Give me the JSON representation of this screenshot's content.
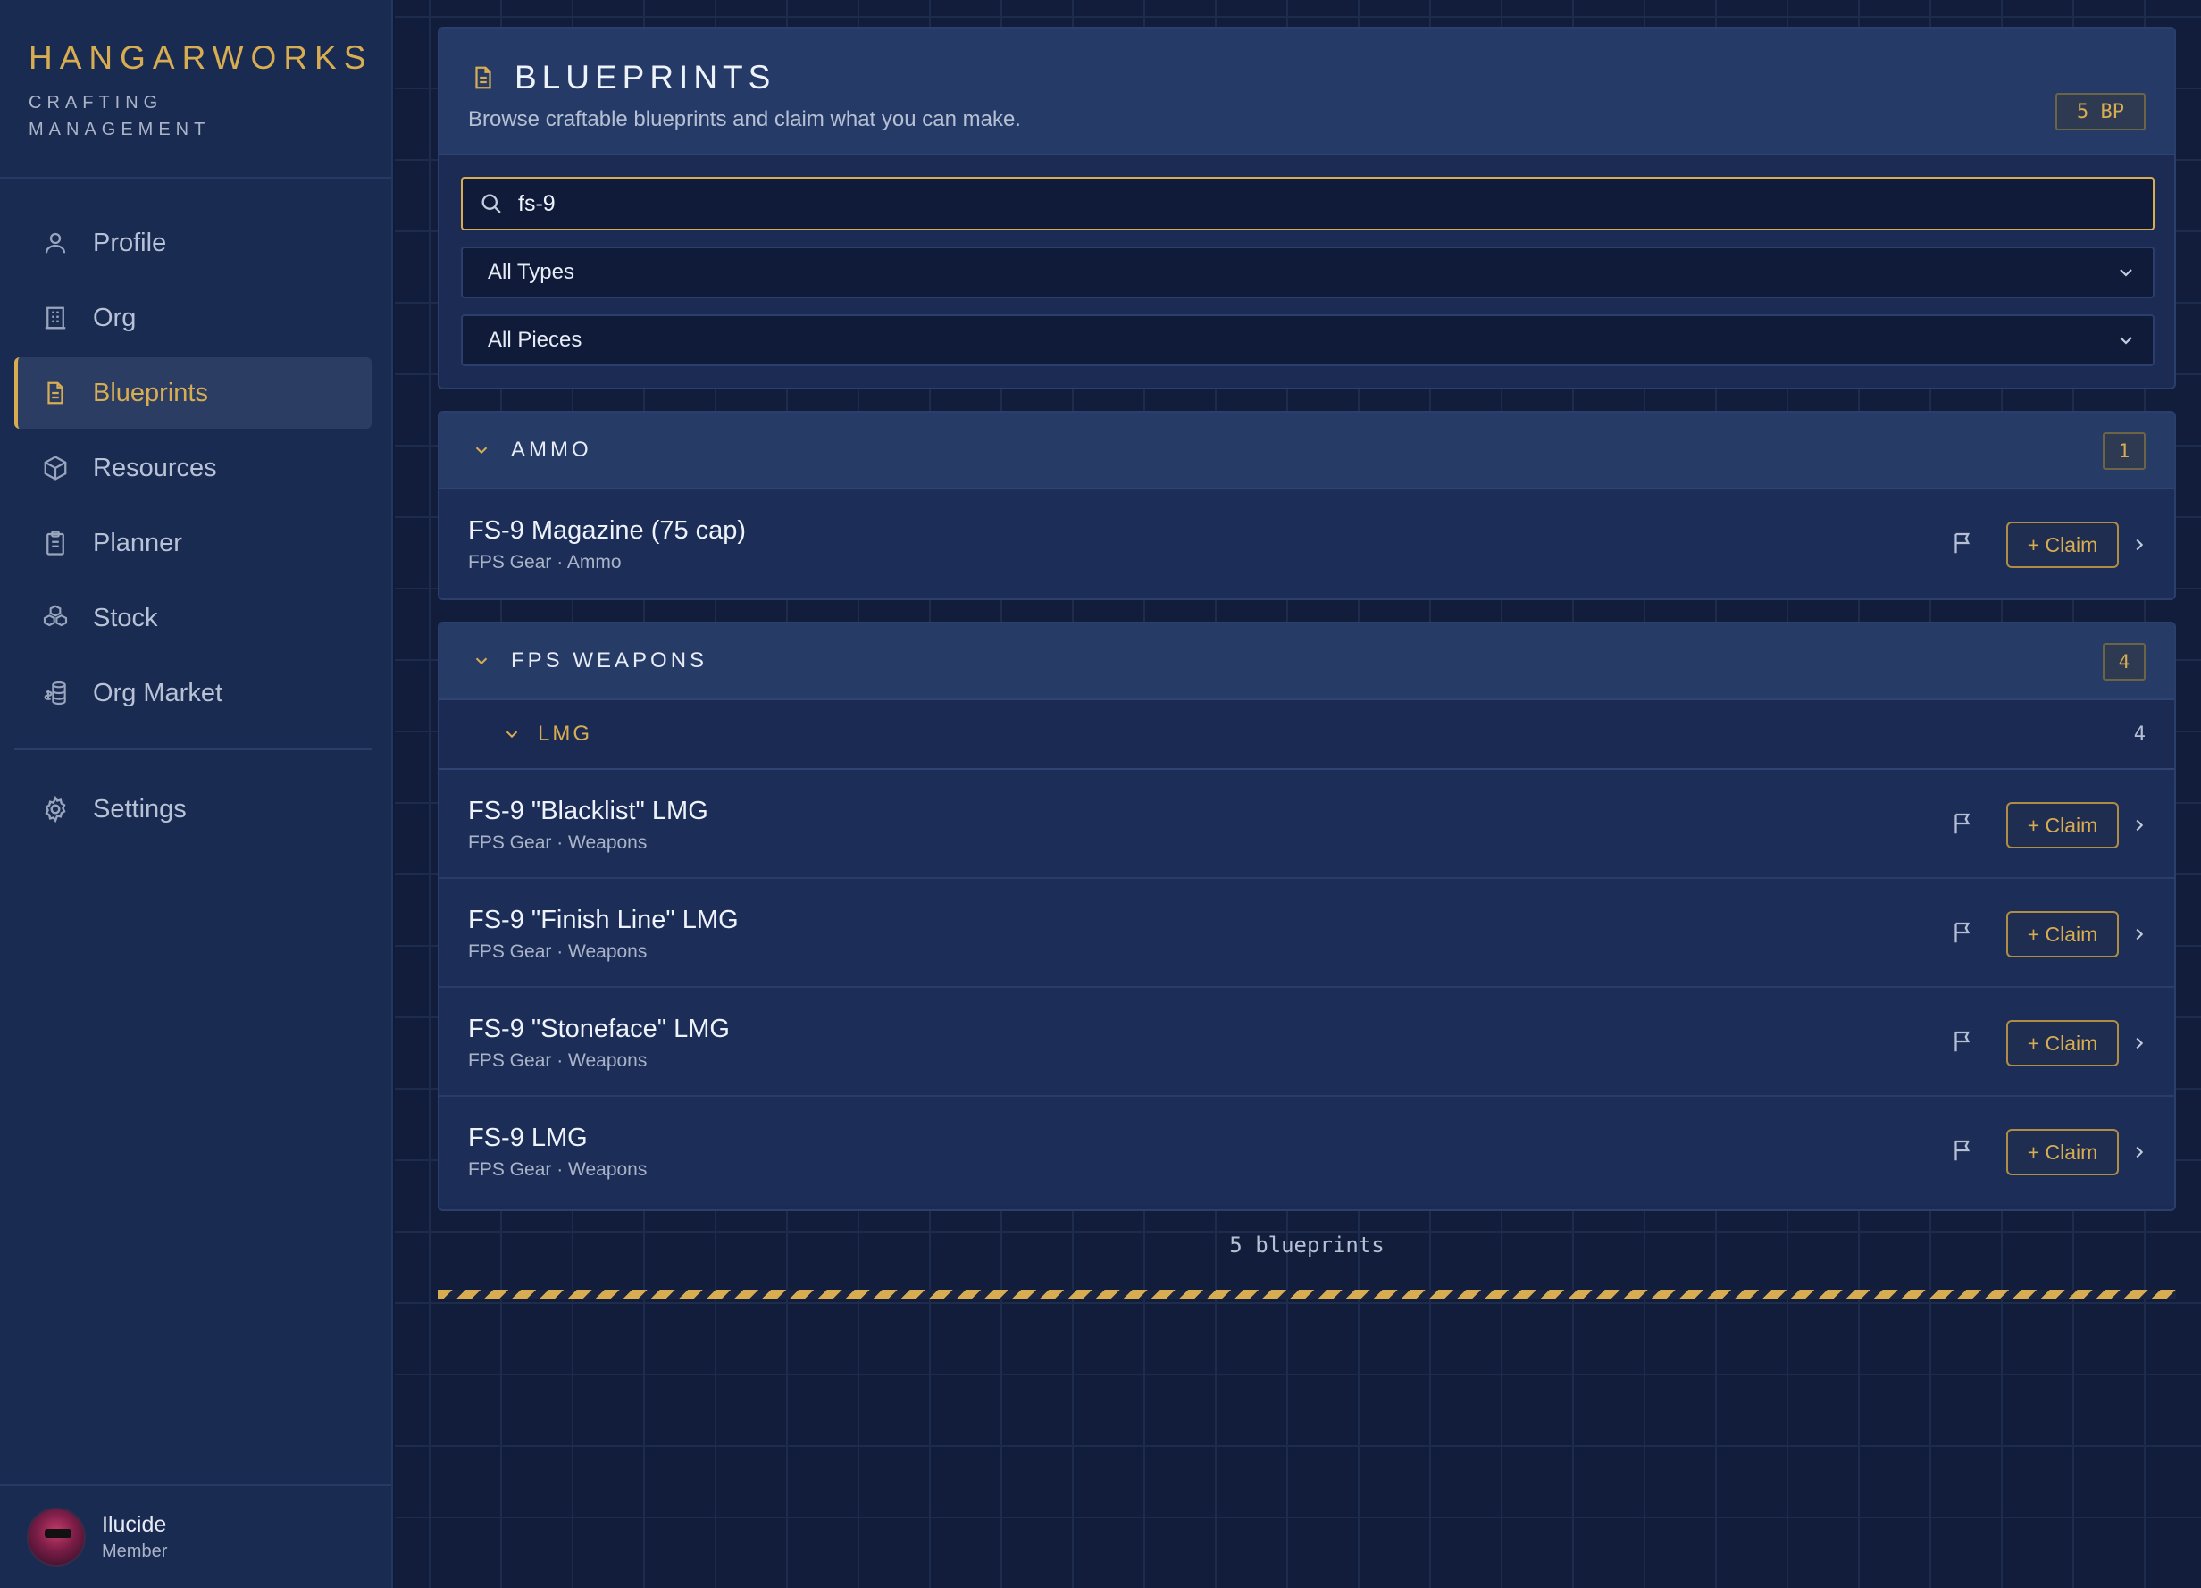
{
  "brand": {
    "title": "HANGARWORKS",
    "subtitle": "CRAFTING MANAGEMENT"
  },
  "nav": {
    "items": [
      {
        "label": "Profile",
        "icon": "user-icon"
      },
      {
        "label": "Org",
        "icon": "building-icon"
      },
      {
        "label": "Blueprints",
        "icon": "document-icon",
        "active": true
      },
      {
        "label": "Resources",
        "icon": "cube-icon"
      },
      {
        "label": "Planner",
        "icon": "clipboard-icon"
      },
      {
        "label": "Stock",
        "icon": "boxes-icon"
      },
      {
        "label": "Org Market",
        "icon": "coins-icon"
      }
    ],
    "settings": {
      "label": "Settings",
      "icon": "gear-icon"
    }
  },
  "user": {
    "name": "Ilucide",
    "role": "Member"
  },
  "header": {
    "title": "BLUEPRINTS",
    "description": "Browse craftable blueprints and claim what you can make.",
    "badge": "5 BP"
  },
  "filters": {
    "search_value": "fs-9",
    "type_selected": "All Types",
    "piece_selected": "All Pieces"
  },
  "groups": {
    "ammo": {
      "title": "AMMO",
      "count": "1",
      "items": [
        {
          "name": "FS-9 Magazine (75 cap)",
          "meta": "FPS Gear · Ammo",
          "claim": "+ Claim"
        }
      ]
    },
    "fps": {
      "title": "FPS WEAPONS",
      "count": "4",
      "sub": {
        "title": "LMG",
        "count": "4"
      },
      "items": [
        {
          "name": "FS-9 \"Blacklist\" LMG",
          "meta": "FPS Gear · Weapons",
          "claim": "+ Claim"
        },
        {
          "name": "FS-9 \"Finish Line\" LMG",
          "meta": "FPS Gear · Weapons",
          "claim": "+ Claim"
        },
        {
          "name": "FS-9 \"Stoneface\" LMG",
          "meta": "FPS Gear · Weapons",
          "claim": "+ Claim"
        },
        {
          "name": "FS-9 LMG",
          "meta": "FPS Gear · Weapons",
          "claim": "+ Claim"
        }
      ]
    }
  },
  "footer": {
    "count_text": "5 blueprints"
  },
  "colors": {
    "accent": "#d8ad52",
    "background": "#111d3a",
    "sidebar": "#1a2b52"
  }
}
